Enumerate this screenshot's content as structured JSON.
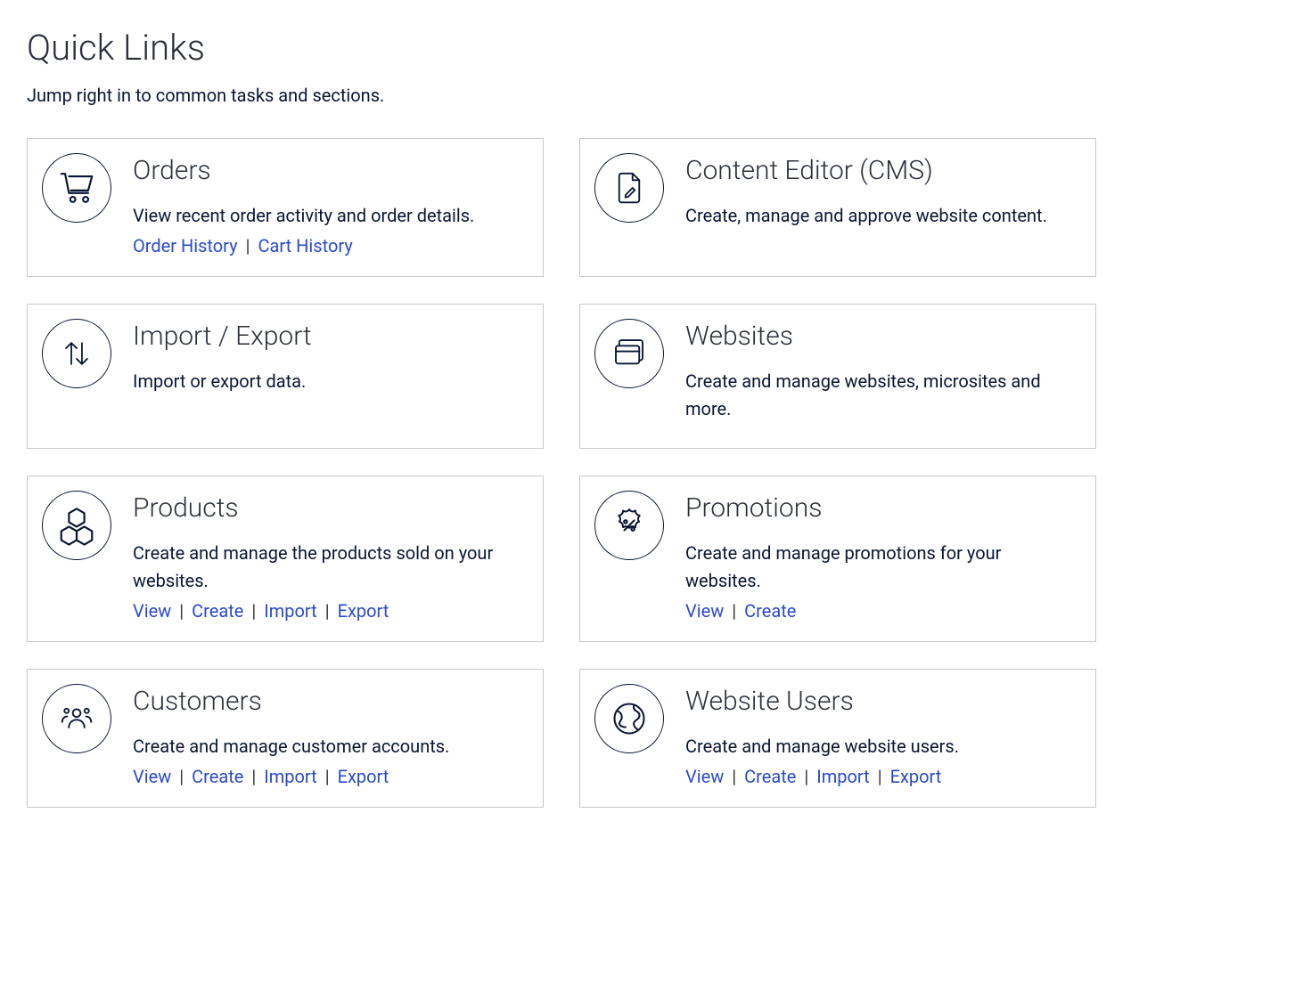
{
  "page": {
    "title": "Quick Links",
    "subtitle": "Jump right in to common tasks and sections."
  },
  "cards": [
    {
      "icon": "cart-icon",
      "title": "Orders",
      "desc": "View recent order activity and order details.",
      "links": [
        "Order History",
        "Cart History"
      ]
    },
    {
      "icon": "file-edit-icon",
      "title": "Content Editor (CMS)",
      "desc": "Create, manage and approve website content.",
      "links": []
    },
    {
      "icon": "import-export-icon",
      "title": "Import / Export",
      "desc": "Import or export data.",
      "links": []
    },
    {
      "icon": "windows-icon",
      "title": "Websites",
      "desc": "Create and manage websites, microsites and more.",
      "links": []
    },
    {
      "icon": "boxes-icon",
      "title": "Products",
      "desc": "Create and manage the products sold on your websites.",
      "links": [
        "View",
        "Create",
        "Import",
        "Export"
      ]
    },
    {
      "icon": "promo-icon",
      "title": "Promotions",
      "desc": "Create and manage promotions for your websites.",
      "links": [
        "View",
        "Create"
      ]
    },
    {
      "icon": "customers-icon",
      "title": "Customers",
      "desc": "Create and manage customer accounts.",
      "links": [
        "View",
        "Create",
        "Import",
        "Export"
      ]
    },
    {
      "icon": "globe-icon",
      "title": "Website Users",
      "desc": "Create and manage website users.",
      "links": [
        "View",
        "Create",
        "Import",
        "Export"
      ]
    }
  ]
}
